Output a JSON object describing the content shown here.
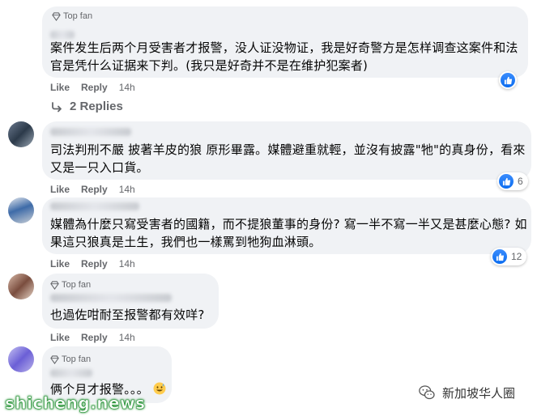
{
  "comments": [
    {
      "badge": "Top fan",
      "text_lines": [
        "案件发生后两个月受害者才报警，没人证没物证，我是好奇警方是怎样调查这案件和法",
        "官是凭什么证据来下判。(我只是好奇并不是在维护犯案者)"
      ],
      "like": "Like",
      "reply": "Reply",
      "time": "14h",
      "reaction_count": "",
      "replies_label": "2 Replies"
    },
    {
      "badge": "",
      "text_lines": [
        "司法判刑不嚴 披著羊皮的狼 原形畢露。媒體避重就輕，並沒有披露\"牠\"的真身份，看來",
        "又是一只入口貨。"
      ],
      "like": "Like",
      "reply": "Reply",
      "time": "14h",
      "reaction_count": "6"
    },
    {
      "badge": "",
      "text_lines": [
        "媒體為什麼只寫受害者的國籍，而不提狼董事的身份? 寫一半不寫一半又是甚麼心態? 如",
        "果這只狼真是土生，我們也一樣罵到牠狗血淋頭。"
      ],
      "like": "Like",
      "reply": "Reply",
      "time": "14h",
      "reaction_count": "12"
    },
    {
      "badge": "Top fan",
      "text_lines": [
        "也過佐咁耐至报警都有效咩?"
      ],
      "like": "Like",
      "reply": "Reply",
      "time": "14h",
      "reaction_count": ""
    },
    {
      "badge": "Top fan",
      "text_lines": [
        "俩个月才报警。。。"
      ],
      "like": "",
      "reply": "",
      "time": "",
      "reaction_count": ""
    }
  ],
  "watermarks": {
    "left": "shicheng.news",
    "right": "新加坡华人圈",
    "right_icon": "wechat-icon"
  },
  "colors": {
    "bubble": "#f0f2f5",
    "like_blue": "#0a6cf0",
    "muted": "#65676b"
  }
}
